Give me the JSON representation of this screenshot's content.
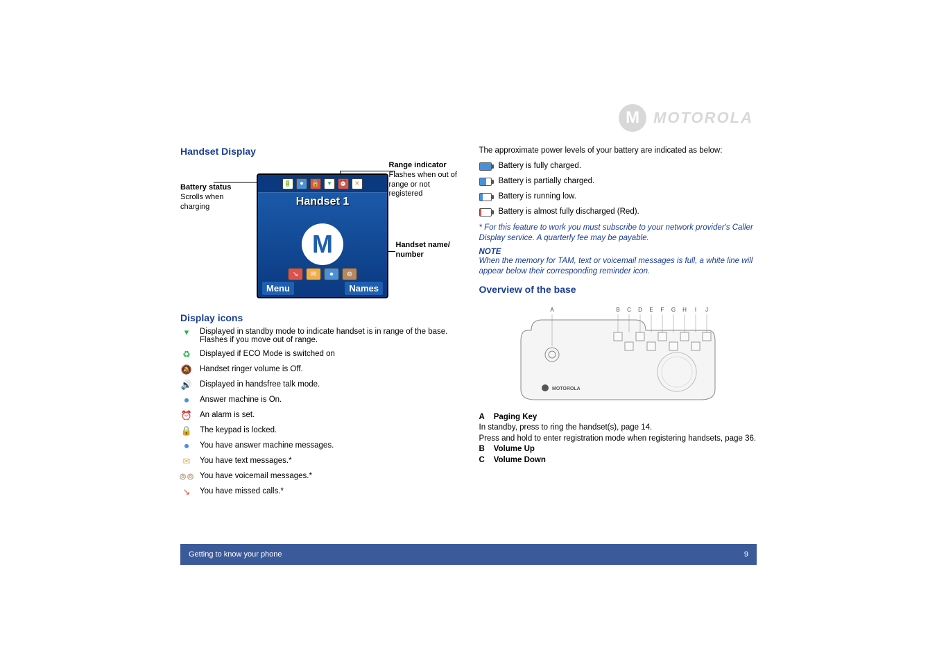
{
  "logo": {
    "brand": "MOTOROLA",
    "emblem": "M"
  },
  "left": {
    "handset_display_title": "Handset Display",
    "callouts": {
      "battery": {
        "title": "Battery status",
        "desc": "Scrolls when charging"
      },
      "range": {
        "title": "Range indicator",
        "desc": "Flashes when out of range or not registered"
      },
      "handset": {
        "title": "Handset name/ number"
      }
    },
    "phone": {
      "handset_name": "Handset 1",
      "softkey_left": "Menu",
      "softkey_right": "Names",
      "moto_emblem": "M"
    },
    "display_icons_title": "Display icons",
    "icons": [
      {
        "name": "antenna-icon",
        "glyph": "▾",
        "color": "#2bb24c",
        "text": "Displayed in standby mode to indicate handset is in range of the base. Flashes if you move out of range."
      },
      {
        "name": "eco-icon",
        "glyph": "♻",
        "color": "#2bb24c",
        "text": "Displayed if ECO Mode is switched on"
      },
      {
        "name": "ringer-off-icon",
        "glyph": "🔕",
        "color": "#d94",
        "text": "Handset ringer volume is Off."
      },
      {
        "name": "handsfree-icon",
        "glyph": "🔊",
        "color": "#4a90d9",
        "text": "Displayed in handsfree talk mode."
      },
      {
        "name": "tam-on-icon",
        "glyph": "⏺",
        "color": "#4a90d9",
        "text": "Answer machine is On."
      },
      {
        "name": "alarm-icon",
        "glyph": "⏰",
        "color": "#d9534f",
        "text": "An alarm is set."
      },
      {
        "name": "keypad-lock-icon",
        "glyph": "🔒",
        "color": "#d9534f",
        "text": "The keypad is locked."
      },
      {
        "name": "tam-msg-icon",
        "glyph": "⏺",
        "color": "#4a90d9",
        "text": "You have answer machine messages."
      },
      {
        "name": "text-msg-icon",
        "glyph": "✉",
        "color": "#f0ad4e",
        "text": "You have text messages.*"
      },
      {
        "name": "voicemail-icon",
        "glyph": "⊚⊚",
        "color": "#b58863",
        "text": "You have voicemail messages.*"
      },
      {
        "name": "missed-call-icon",
        "glyph": "↘",
        "color": "#d9534f",
        "text": "You have missed calls.*"
      }
    ]
  },
  "right": {
    "intro": "The approximate power levels of your battery are indicated as below:",
    "battery_levels": [
      {
        "name": "battery-full-icon",
        "fill": "100%",
        "color": "#4a90d9",
        "text": "Battery is fully charged."
      },
      {
        "name": "battery-partial-icon",
        "fill": "60%",
        "color": "#4a90d9",
        "text": "Battery is partially charged."
      },
      {
        "name": "battery-low-icon",
        "fill": "25%",
        "color": "#4a90d9",
        "text": "Battery is running low."
      },
      {
        "name": "battery-empty-icon",
        "fill": "15%",
        "color": "#d9534f",
        "text": "Battery is almost fully discharged (Red)."
      }
    ],
    "footnote": "* For this feature to work you must subscribe to your network provider's Caller Display service. A quarterly fee may be payable.",
    "note_title": "NOTE",
    "note_body": "When the memory for TAM, text or voicemail messages is full, a white line will appear below their corresponding reminder icon.",
    "overview_title": "Overview of the base",
    "base_labels": [
      "A",
      "B",
      "C",
      "D",
      "E",
      "F",
      "G",
      "H",
      "I",
      "J"
    ],
    "base_brand": "MOTOROLA",
    "keys": {
      "a_label": "A",
      "a_title": "Paging Key",
      "a_desc1": "In standby, press to ring the handset(s), page 14.",
      "a_desc2": "Press and hold to enter registration mode when registering handsets, page 36.",
      "b_label": "B",
      "b_title": "Volume Up",
      "c_label": "C",
      "c_title": "Volume Down"
    }
  },
  "footer": {
    "section": "Getting to know your phone",
    "page": "9"
  }
}
